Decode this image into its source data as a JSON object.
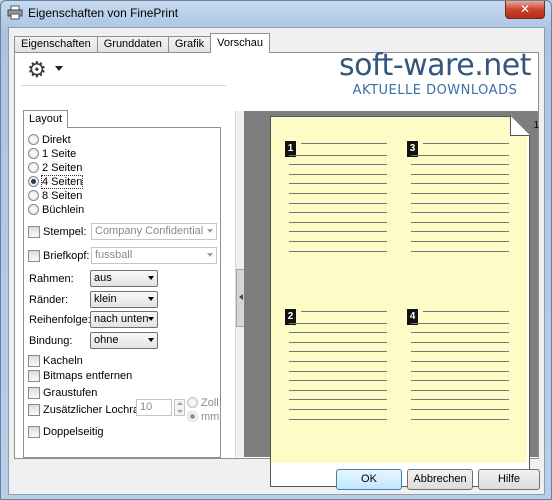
{
  "window": {
    "title": "Eigenschaften von FinePrint",
    "close_symbol": "✕"
  },
  "tabs": [
    "Eigenschaften",
    "Grunddaten",
    "Grafik",
    "Vorschau"
  ],
  "active_tab": "Vorschau",
  "toolbar": {
    "settings_icon": "gear-icon"
  },
  "watermark": {
    "brand": "soft-ware.net",
    "subtitle": "AKTUELLE DOWNLOADS"
  },
  "layout": {
    "tab_label": "Layout",
    "pages_per_sheet": [
      {
        "label": "Direkt",
        "checked": false
      },
      {
        "label": "1 Seite",
        "checked": false
      },
      {
        "label": "2 Seiten",
        "checked": false
      },
      {
        "label": "4 Seiten",
        "checked": true
      },
      {
        "label": "8 Seiten",
        "checked": false
      },
      {
        "label": "Büchlein",
        "checked": false
      }
    ],
    "stempel": {
      "label": "Stempel:",
      "value": "Company Confidential",
      "checked": false
    },
    "briefkopf": {
      "label": "Briefkopf:",
      "value": "fussball",
      "checked": false
    },
    "rahmen": {
      "label": "Rahmen:",
      "value": "aus"
    },
    "raender": {
      "label": "Ränder:",
      "value": "klein"
    },
    "reihenfolge": {
      "label": "Reihenfolge:",
      "value": "nach unten"
    },
    "bindung": {
      "label": "Bindung:",
      "value": "ohne"
    },
    "kacheln": {
      "label": "Kacheln",
      "checked": false
    },
    "bitmaps": {
      "label": "Bitmaps entfernen",
      "checked": false
    },
    "graustufen": {
      "label": "Graustufen",
      "checked": false
    },
    "lochrand": {
      "label": "Zusätzlicher Lochrand",
      "value": "10",
      "checked": false,
      "unit_zoll": "Zoll",
      "unit_mm": "mm"
    },
    "doppelseitig": {
      "label": "Doppelseitig",
      "checked": false
    }
  },
  "preview": {
    "page_number": "1",
    "subpages": [
      "1",
      "3",
      "2",
      "4"
    ]
  },
  "buttons": {
    "ok": "OK",
    "cancel": "Abbrechen",
    "help": "Hilfe"
  }
}
